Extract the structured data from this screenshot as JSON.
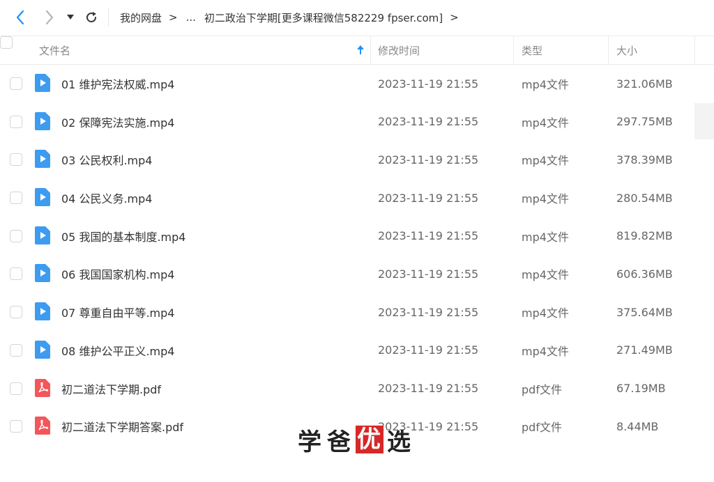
{
  "toolbar": {
    "back_icon": "chevron-left-icon",
    "forward_icon": "chevron-right-icon",
    "dropdown_icon": "caret-down-icon",
    "refresh_icon": "refresh-icon"
  },
  "breadcrumb": {
    "root": "我的网盘",
    "separator": ">",
    "ellipsis": "...",
    "current": "初二政治下学期[更多课程微信582229 fpser.com]"
  },
  "header": {
    "name": "文件名",
    "modified": "修改时间",
    "type": "类型",
    "size": "大小"
  },
  "files": [
    {
      "name": "01 维护宪法权威.mp4",
      "modified": "2023-11-19 21:55",
      "type": "mp4文件",
      "size": "321.06MB",
      "icon": "video"
    },
    {
      "name": "02 保障宪法实施.mp4",
      "modified": "2023-11-19 21:55",
      "type": "mp4文件",
      "size": "297.75MB",
      "icon": "video"
    },
    {
      "name": "03 公民权利.mp4",
      "modified": "2023-11-19 21:55",
      "type": "mp4文件",
      "size": "378.39MB",
      "icon": "video"
    },
    {
      "name": "04 公民义务.mp4",
      "modified": "2023-11-19 21:55",
      "type": "mp4文件",
      "size": "280.54MB",
      "icon": "video"
    },
    {
      "name": "05 我国的基本制度.mp4",
      "modified": "2023-11-19 21:55",
      "type": "mp4文件",
      "size": "819.82MB",
      "icon": "video"
    },
    {
      "name": "06 我国国家机构.mp4",
      "modified": "2023-11-19 21:55",
      "type": "mp4文件",
      "size": "606.36MB",
      "icon": "video"
    },
    {
      "name": "07 尊重自由平等.mp4",
      "modified": "2023-11-19 21:55",
      "type": "mp4文件",
      "size": "375.64MB",
      "icon": "video"
    },
    {
      "name": "08 维护公平正义.mp4",
      "modified": "2023-11-19 21:55",
      "type": "mp4文件",
      "size": "271.49MB",
      "icon": "video"
    },
    {
      "name": "初二道法下学期.pdf",
      "modified": "2023-11-19 21:55",
      "type": "pdf文件",
      "size": "67.19MB",
      "icon": "pdf"
    },
    {
      "name": "初二道法下学期答案.pdf",
      "modified": "2023-11-19 21:55",
      "type": "pdf文件",
      "size": "8.44MB",
      "icon": "pdf"
    }
  ],
  "watermark": {
    "char1": "学",
    "char2": "爸",
    "char3": "优",
    "char4": "选"
  },
  "colors": {
    "accent": "#1e90ff",
    "video_icon": "#3d9bf0",
    "pdf_icon": "#f2575b",
    "watermark_red": "#d62828"
  }
}
